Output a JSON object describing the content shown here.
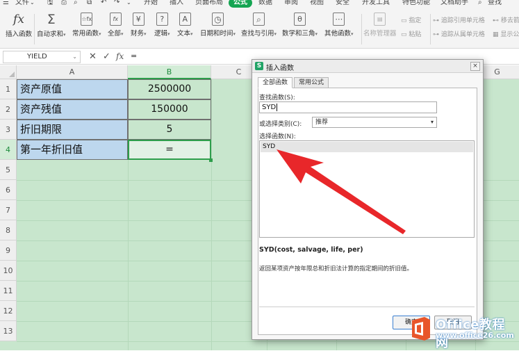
{
  "menubar": {
    "items": [
      "文件",
      "开始",
      "插入",
      "页面布局",
      "公式",
      "数据",
      "审阅",
      "视图",
      "安全",
      "开发工具",
      "特色功能",
      "文档助手",
      "查找"
    ],
    "active": "公式"
  },
  "ribbon": {
    "buttons": [
      {
        "label": "插入函数",
        "icon": "fx-icon",
        "glyph": "fx"
      },
      {
        "label": "自动求和",
        "icon": "sigma-icon",
        "glyph": "Σ"
      },
      {
        "label": "常用函数",
        "icon": "star-function-icon",
        "glyph": "☆fx"
      },
      {
        "label": "全部",
        "icon": "all-function-icon",
        "glyph": "fx"
      },
      {
        "label": "财务",
        "icon": "finance-icon",
        "glyph": "¥"
      },
      {
        "label": "逻辑",
        "icon": "logic-icon",
        "glyph": "?"
      },
      {
        "label": "文本",
        "icon": "text-icon",
        "glyph": "A"
      },
      {
        "label": "日期和时间",
        "icon": "clock-icon",
        "glyph": "◷"
      },
      {
        "label": "查找与引用",
        "icon": "lookup-icon",
        "glyph": "⌕"
      },
      {
        "label": "数学和三角",
        "icon": "math-icon",
        "glyph": "θ"
      },
      {
        "label": "其他函数",
        "icon": "more-function-icon",
        "glyph": "⋯"
      },
      {
        "label": "名称管理器",
        "icon": "name-manager-icon",
        "glyph": "▤"
      }
    ],
    "small": [
      "指定",
      "粘贴",
      "追踪引用单元格",
      "追踪从属单元格",
      "移去箭",
      "显示公"
    ]
  },
  "formula_bar": {
    "name_box": "YIELD",
    "cancel": "✕",
    "confirm": "✓",
    "fx": "fx",
    "value": "="
  },
  "sheet": {
    "columns": [
      "A",
      "B",
      "C",
      "D",
      "E",
      "F",
      "G"
    ],
    "rows": [
      "1",
      "2",
      "3",
      "4",
      "5",
      "6",
      "7",
      "8",
      "9",
      "10",
      "11",
      "12",
      "13"
    ],
    "data": [
      {
        "a": "资产原值",
        "b": "2500000"
      },
      {
        "a": "资产残值",
        "b": "150000"
      },
      {
        "a": "折旧期限",
        "b": "5"
      },
      {
        "a": "第一年折旧值",
        "b": "="
      }
    ]
  },
  "dialog": {
    "title": "插入函数",
    "close": "×",
    "tabs": [
      "全部函数",
      "常用公式"
    ],
    "search_label": "查找函数(S):",
    "search_value": "SYD",
    "category_label": "或选择类别(C):",
    "category_value": "推荐",
    "select_label": "选择函数(N):",
    "functions": [
      "SYD"
    ],
    "syntax": "SYD(cost, salvage, life, per)",
    "description": "返回某项资产按年限总和折旧法计算的指定期间的折旧值。",
    "ok": "确定",
    "cancel": "取消"
  },
  "watermark": {
    "main": "Office教程网",
    "sub": "www.office26.com"
  },
  "colors": {
    "accent": "#15a552",
    "sheet_bg": "#c8e6cd",
    "label_cell": "#bdd7ee",
    "arrow": "#e8272a"
  }
}
